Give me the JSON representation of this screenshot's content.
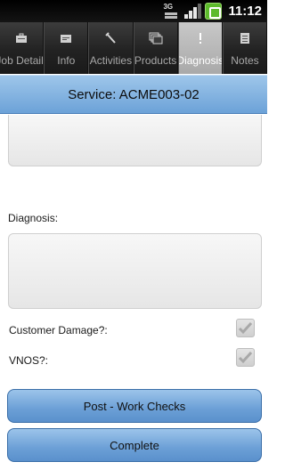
{
  "status_bar": {
    "network_label": "3G",
    "time": "11:12",
    "icons": [
      "network-3g-icon",
      "signal-strength-icon",
      "battery-icon"
    ]
  },
  "tabs": [
    {
      "label": "Job Details",
      "icon": "briefcase-icon",
      "active": false
    },
    {
      "label": "Info",
      "icon": "info-card-icon",
      "active": false
    },
    {
      "label": "Activities",
      "icon": "tools-icon",
      "active": false
    },
    {
      "label": "Products",
      "icon": "stack-icon",
      "active": false
    },
    {
      "label": "Diagnosis",
      "icon": "diagnosis-icon",
      "active": true
    },
    {
      "label": "Notes",
      "icon": "notes-icon",
      "active": false
    }
  ],
  "header": {
    "title": "Service: ACME003-02"
  },
  "form": {
    "previous_text_value": "",
    "diagnosis_label": "Diagnosis:",
    "diagnosis_value": "",
    "customer_damage_label": "Customer Damage?:",
    "customer_damage_checked": false,
    "vnos_label": "VNOS?:",
    "vnos_checked": false
  },
  "buttons": {
    "post_work_checks": "Post - Work Checks",
    "complete": "Complete"
  },
  "colors": {
    "accent_blue": "#7aaee0",
    "active_tab": "#b5b5b5",
    "battery_green": "#5dbb2c"
  }
}
